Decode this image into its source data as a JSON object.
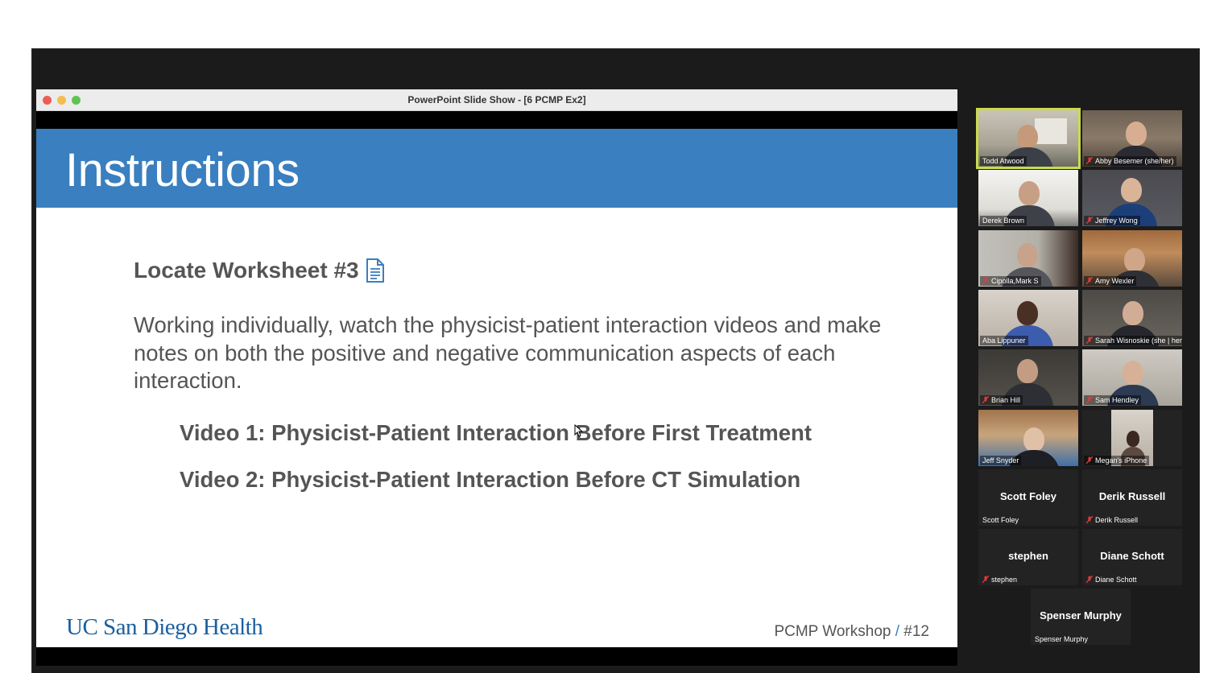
{
  "ppt_window": {
    "title": "PowerPoint Slide Show - [6 PCMP Ex2]"
  },
  "slide": {
    "title": "Instructions",
    "worksheet_heading": "Locate Worksheet #3",
    "body": "Working individually, watch the physicist-patient interaction videos and make notes on both the positive and negative communication aspects of each interaction.",
    "video1": "Video 1: Physicist-Patient Interaction Before First Treatment",
    "video2": "Video 2: Physicist-Patient Interaction Before CT Simulation",
    "logo_text": "UC San Diego Health",
    "footer_label": "PCMP Workshop",
    "footer_sep": "/",
    "footer_number": "#12",
    "header_color": "#3a7fbf"
  },
  "gallery": {
    "video_tiles": [
      {
        "name": "Todd Atwood",
        "muted": false,
        "active": true
      },
      {
        "name": "Abby Besemer (she/her)",
        "muted": true,
        "active": false
      },
      {
        "name": "Derek Brown",
        "muted": false,
        "active": false
      },
      {
        "name": "Jeffrey Wong",
        "muted": true,
        "active": false
      },
      {
        "name": "Cipolla,Mark S",
        "muted": true,
        "active": false
      },
      {
        "name": "Amy Wexler",
        "muted": true,
        "active": false
      },
      {
        "name": "Aba Lippuner",
        "muted": false,
        "active": false
      },
      {
        "name": "Sarah Wisnoskie (she | her)",
        "muted": true,
        "active": false
      },
      {
        "name": "Brian Hill",
        "muted": true,
        "active": false
      },
      {
        "name": "Sam Hendley",
        "muted": true,
        "active": false
      },
      {
        "name": "Jeff Snyder",
        "muted": false,
        "active": false
      },
      {
        "name": "Megan's iPhone",
        "muted": true,
        "active": false
      }
    ],
    "no_video_tiles": [
      {
        "display": "Scott Foley",
        "tag": "Scott Foley",
        "muted": false
      },
      {
        "display": "Derik Russell",
        "tag": "Derik Russell",
        "muted": true
      },
      {
        "display": "stephen",
        "tag": "stephen",
        "muted": true
      },
      {
        "display": "Diane Schott",
        "tag": "Diane Schott",
        "muted": true
      },
      {
        "display": "Spenser Murphy",
        "tag": "Spenser Murphy",
        "muted": false
      }
    ]
  }
}
